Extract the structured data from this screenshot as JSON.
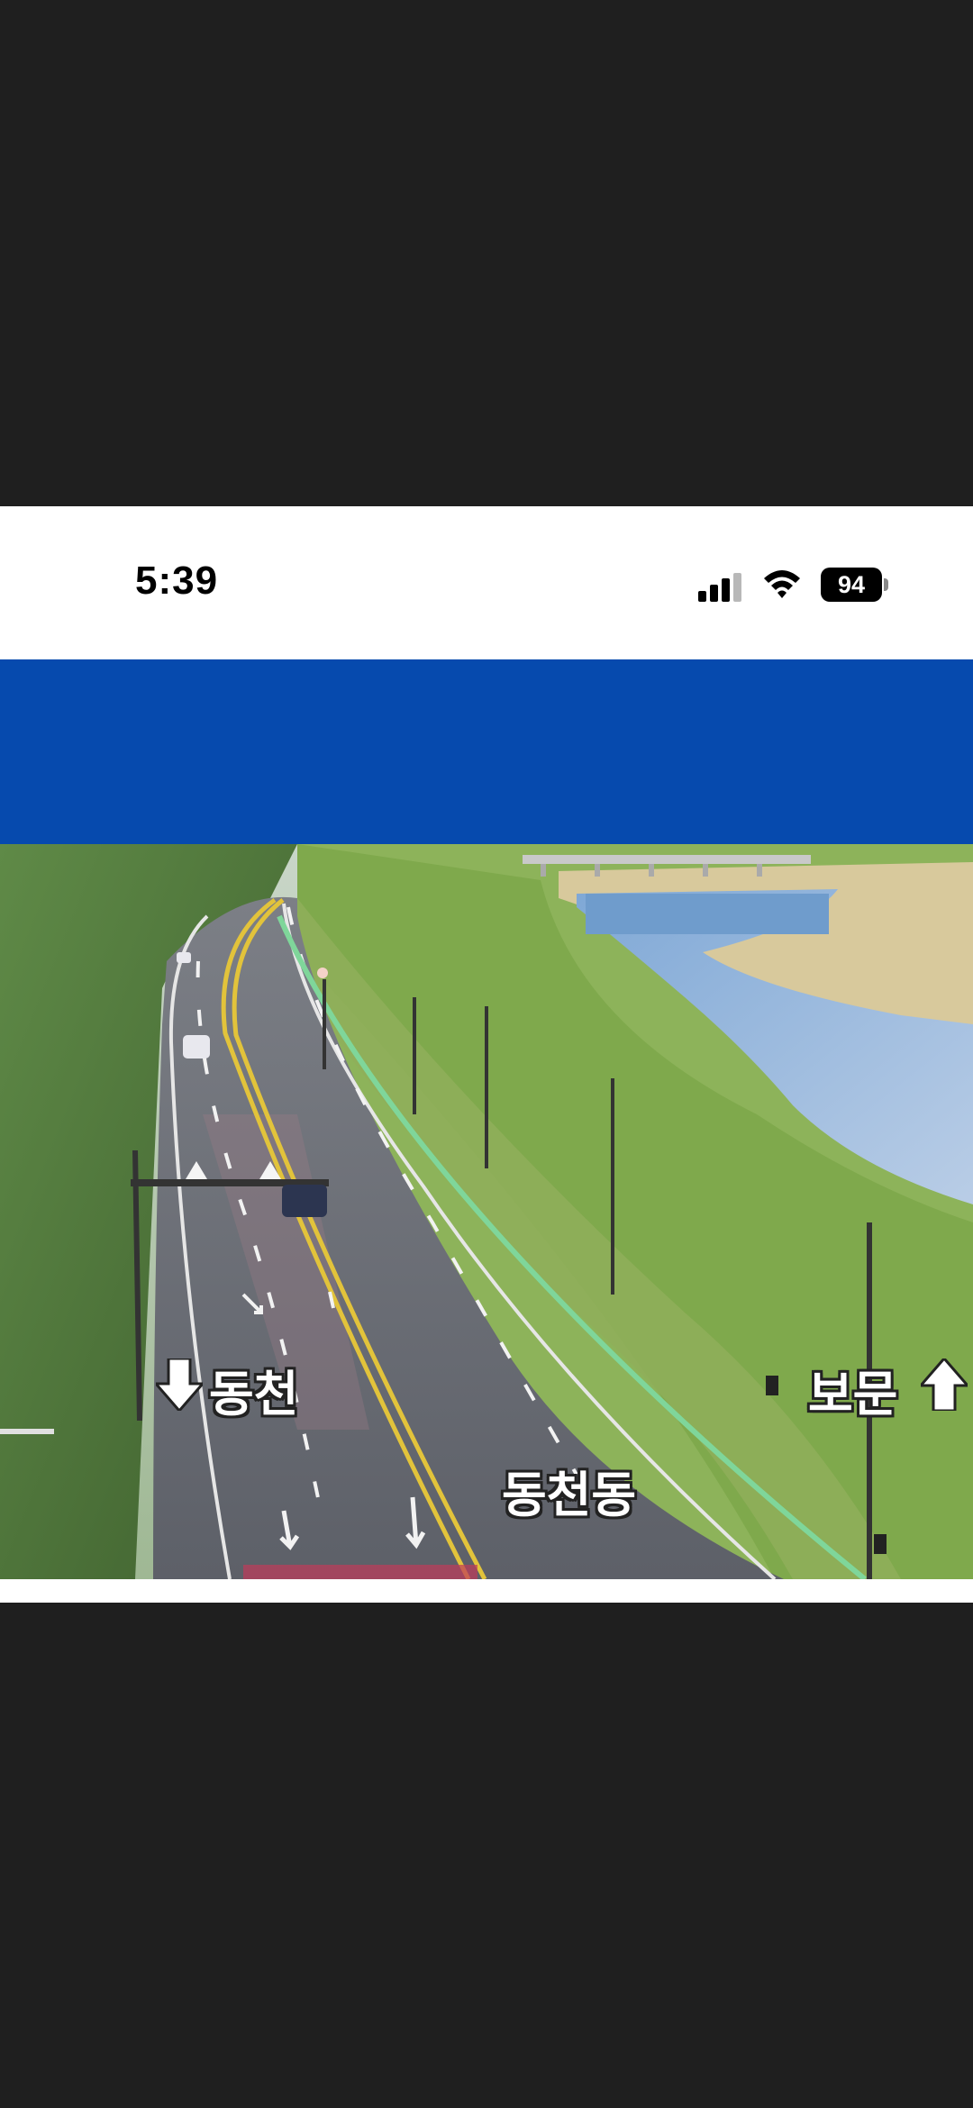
{
  "status_bar": {
    "time": "5:39",
    "battery": "94",
    "signal_icon": "cellular-signal-icon",
    "wifi_icon": "wifi-icon",
    "battery_icon": "battery-icon"
  },
  "colors": {
    "band_blue": "#064aae",
    "background_dark": "#1f1f1f"
  },
  "camera": {
    "label_left": "동천",
    "label_right": "보문",
    "label_center": "동천동",
    "arrow_left_icon": "arrow-down-icon",
    "arrow_right_icon": "arrow-up-icon"
  }
}
